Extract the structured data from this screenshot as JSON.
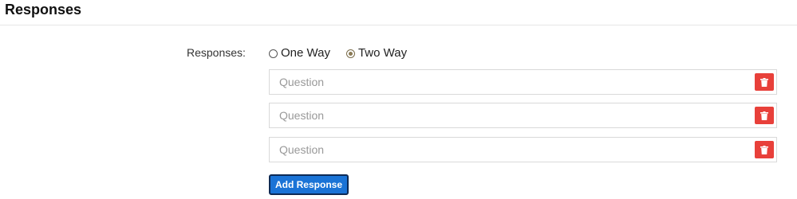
{
  "section": {
    "title": "Responses"
  },
  "form": {
    "responses_label": "Responses:",
    "response_type": {
      "options": [
        {
          "label": "One Way",
          "checked": false
        },
        {
          "label": "Two Way",
          "checked": true
        }
      ],
      "selected": "Two Way"
    },
    "responses": [
      {
        "placeholder": "Question",
        "value": ""
      },
      {
        "placeholder": "Question",
        "value": ""
      },
      {
        "placeholder": "Question",
        "value": ""
      }
    ],
    "add_button_label": "Add Response"
  },
  "colors": {
    "delete_button": "#e8403a",
    "add_button": "#1a73d6",
    "add_button_border": "#0d2a55",
    "radio_checked": "#8a7a55"
  },
  "icons": {
    "delete": "trash-icon"
  }
}
